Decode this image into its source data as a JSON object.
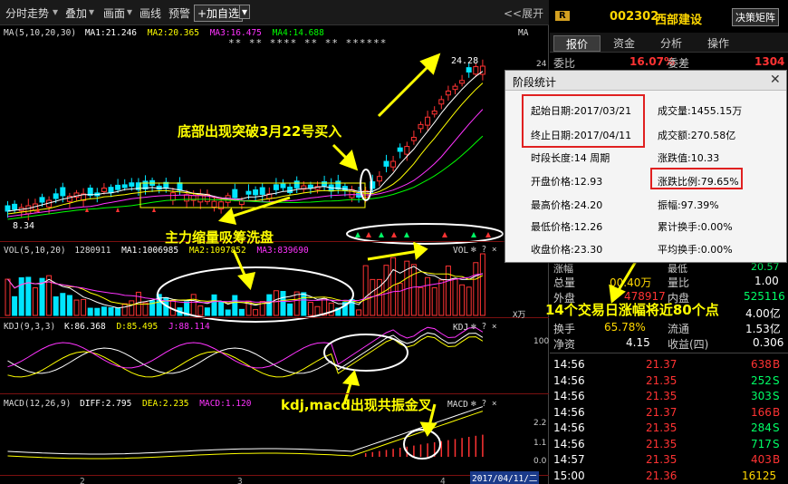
{
  "toolbar": {
    "items": [
      "分时走势",
      "叠加",
      "画面",
      "画线",
      "预警"
    ],
    "add_fav": "+加自选",
    "expand": "<<展开"
  },
  "chart": {
    "ma_legend": {
      "title": "MA(5,10,20,30)",
      "ma1": "MA1:21.246",
      "ma2": "MA2:20.365",
      "ma3": "MA3:16.475",
      "ma4": "MA4:14.688"
    },
    "stars": "** ** **** ** ** ******",
    "ma_tag": "MA",
    "high_label": "24.28",
    "low_label": "8.34",
    "price_axis": [
      "24",
      "20",
      "16",
      "12",
      "8",
      "4"
    ],
    "vol_legend": {
      "title": "VOL(5,10,20)",
      "v": "1280911",
      "ma1": "MA1:1006985",
      "ma2": "MA2:1097852",
      "ma3": "MA3:839690"
    },
    "vol_tag": "VOL",
    "vol_unit": "X万",
    "kdj_legend": {
      "title": "KDJ(9,3,3)",
      "k": "K:86.368",
      "d": "D:85.495",
      "j": "J:88.114"
    },
    "kdj_tag": "KDJ",
    "kdj_axis": [
      "100",
      "50",
      "0"
    ],
    "macd_legend": {
      "title": "MACD(12,26,9)",
      "diff": "DIFF:2.795",
      "dea": "DEA:2.235",
      "macd": "MACD:1.120"
    },
    "macd_tag": "MACD",
    "macd_axis": [
      "2.2",
      "1.1",
      "0.0"
    ],
    "date_box": "2017/04/11/二",
    "x_ticks": [
      "2",
      "3",
      "4"
    ]
  },
  "annotations": {
    "breakout": "底部出现突破3月22号买入",
    "washout": "主力缩量吸筹洗盘",
    "kdj_macd": "kdj,macd出现共振金叉",
    "fourteen": "14个交易日涨幅将近80个点"
  },
  "stock": {
    "badge": "R",
    "code": "002302",
    "name": "西部建设",
    "matrix_btn": "决策矩阵",
    "tabs": [
      "报价",
      "资金",
      "分析",
      "操作"
    ],
    "weibi_label": "委比",
    "weibi_value": "16.07%",
    "weicha_label": "委差",
    "weicha_value": "1304"
  },
  "dialog": {
    "title": "阶段统计",
    "start": "起始日期:2017/03/21",
    "end": "终止日期:2017/04/11",
    "period": "时段长度:14 周期",
    "open": "开盘价格:12.93",
    "high": "最高价格:24.20",
    "low": "最低价格:12.26",
    "close": "收盘价格:23.30",
    "volume": "成交量:1455.15万",
    "amount": "成交额:270.58亿",
    "change_val": "涨跌值:10.33",
    "change_pct": "涨跌比例:79.65%",
    "amplitude": "振幅:97.39%",
    "cum_turnover": "累计换手:0.00%",
    "avg_turnover": "平均换手:0.00%"
  },
  "quote": {
    "partial1": "涨幅",
    "partial2": "最低",
    "partial3": "20.57",
    "total_label": "总量",
    "total_value": "00.40万",
    "ratio_label": "量比",
    "ratio_value": "1.00",
    "out_label": "外盘",
    "out_value": "478917",
    "in_label": "内盘",
    "in_value": "525116",
    "side1": "4.00亿",
    "hs_label": "换手",
    "hs_value": "65.78%",
    "lt_label": "流通",
    "lt_value": "1.53亿",
    "jz_label": "净资",
    "jz_value": "4.15",
    "sy_label": "收益(四)",
    "sy_value": "0.306"
  },
  "trades": [
    {
      "time": "14:56",
      "price": "21.37",
      "vol": "638",
      "side": "B"
    },
    {
      "time": "14:56",
      "price": "21.35",
      "vol": "252",
      "side": "S"
    },
    {
      "time": "14:56",
      "price": "21.35",
      "vol": "303",
      "side": "S"
    },
    {
      "time": "14:56",
      "price": "21.37",
      "vol": "166",
      "side": "B"
    },
    {
      "time": "14:56",
      "price": "21.35",
      "vol": "284",
      "side": "S"
    },
    {
      "time": "14:56",
      "price": "21.35",
      "vol": "717",
      "side": "S"
    },
    {
      "time": "14:57",
      "price": "21.35",
      "vol": "403",
      "side": "B"
    },
    {
      "time": "15:00",
      "price": "21.36",
      "vol": "16125",
      "side": ""
    }
  ],
  "colors": {
    "up": "#ff3333",
    "down": "#00e5ff",
    "ma1": "#ffffff",
    "ma2": "#ffff00",
    "ma3": "#ff33ff",
    "ma4": "#00ff00",
    "annotation": "#ffff00"
  }
}
